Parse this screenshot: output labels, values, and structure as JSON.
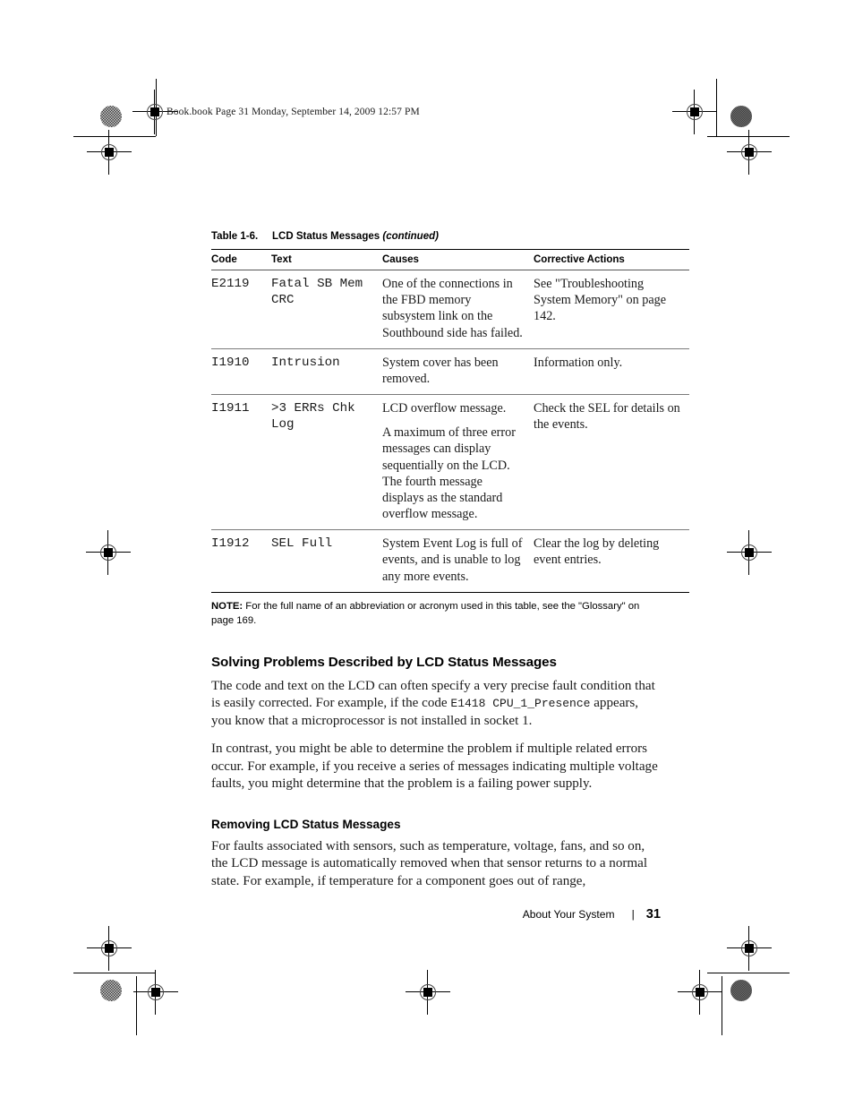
{
  "running_header": "Book.book  Page 31  Monday, September 14, 2009  12:57 PM",
  "table": {
    "caption_number": "Table 1-6.",
    "caption_title": "LCD Status Messages",
    "caption_continued": "(continued)",
    "columns": [
      "Code",
      "Text",
      "Causes",
      "Corrective Actions"
    ],
    "rows": [
      {
        "code": "E2119",
        "text": "Fatal SB Mem CRC",
        "causes": [
          "One of the connections in the FBD memory subsystem link on the Southbound side has failed."
        ],
        "corrective": "See \"Troubleshooting System Memory\" on page 142."
      },
      {
        "code": "I1910",
        "text": "Intrusion",
        "causes": [
          "System cover has been removed."
        ],
        "corrective": "Information only."
      },
      {
        "code": "I1911",
        "text": ">3 ERRs Chk Log",
        "causes": [
          "LCD overflow message.",
          "A maximum of three error messages can display sequentially on the LCD. The fourth message displays as the standard overflow message."
        ],
        "corrective": "Check the SEL for details on the events."
      },
      {
        "code": "I1912",
        "text": "SEL Full",
        "causes": [
          "System Event Log is full of events, and is unable to log any more events."
        ],
        "corrective": "Clear the log by deleting event entries."
      }
    ],
    "note_label": "NOTE:",
    "note_text": "For the full name of an abbreviation or acronym used in this table, see the \"Glossary\" on page 169."
  },
  "sections": [
    {
      "heading": "Solving Problems Described by LCD Status Messages",
      "paragraphs": [
        {
          "part1": "The code and text on the LCD can often specify a very precise fault condition that is easily corrected. For example, if the code ",
          "mono": "E1418   CPU_1_Presence",
          "part2": " appears, you know that a microprocessor is not installed in socket 1."
        },
        {
          "part1": "In contrast, you might be able to determine the problem if multiple related errors occur. For example, if you receive a series of messages indicating multiple voltage faults, you might determine that the problem is a failing power supply.",
          "mono": "",
          "part2": ""
        }
      ]
    },
    {
      "heading": "Removing LCD Status Messages",
      "paragraphs": [
        {
          "part1": "For faults associated with sensors, such as temperature, voltage, fans, and so on, the LCD message is automatically removed when that sensor returns to a normal state. For example, if temperature for a component goes out of range,",
          "mono": "",
          "part2": ""
        }
      ]
    }
  ],
  "footer": {
    "chapter": "About Your System",
    "separator": "|",
    "page_number": "31"
  }
}
